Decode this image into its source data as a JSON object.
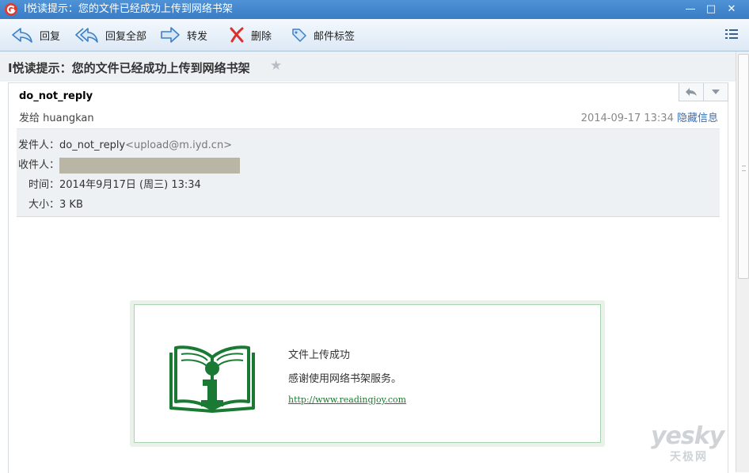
{
  "window": {
    "title": "I悦读提示：您的文件已经成功上传到网络书架",
    "minimize": "—",
    "maximize": "□",
    "close": "✕"
  },
  "toolbar": {
    "reply": "回复",
    "reply_all": "回复全部",
    "forward": "转发",
    "delete": "删除",
    "tag": "邮件标签"
  },
  "mail": {
    "subject": "I悦读提示：您的文件已经成功上传到网络书架",
    "sender_name": "do_not_reply",
    "sent_to_prefix": "发给",
    "sent_to": "huangkan",
    "date": "2014-09-17 13:34",
    "hide_info": "隐藏信息",
    "details": {
      "from_label": "发件人：",
      "from_name": "do_not_reply",
      "from_addr": "<upload@m.iyd.cn>",
      "to_label": "收件人：",
      "time_label": "时间：",
      "time_value": "2014年9月17日 (周三) 13:34",
      "size_label": "大小：",
      "size_value": "3 KB"
    }
  },
  "body": {
    "title": "文件上传成功",
    "text": "感谢使用网络书架服务。",
    "link": "http://www.readingjoy.com"
  },
  "watermark": {
    "brand": "yesky",
    "cn": "天极网"
  },
  "colors": {
    "titlebar": "#3a7cc5",
    "link_blue": "#3a6fb5",
    "logo_green": "#1a7a33",
    "delete_red": "#d9312b"
  }
}
